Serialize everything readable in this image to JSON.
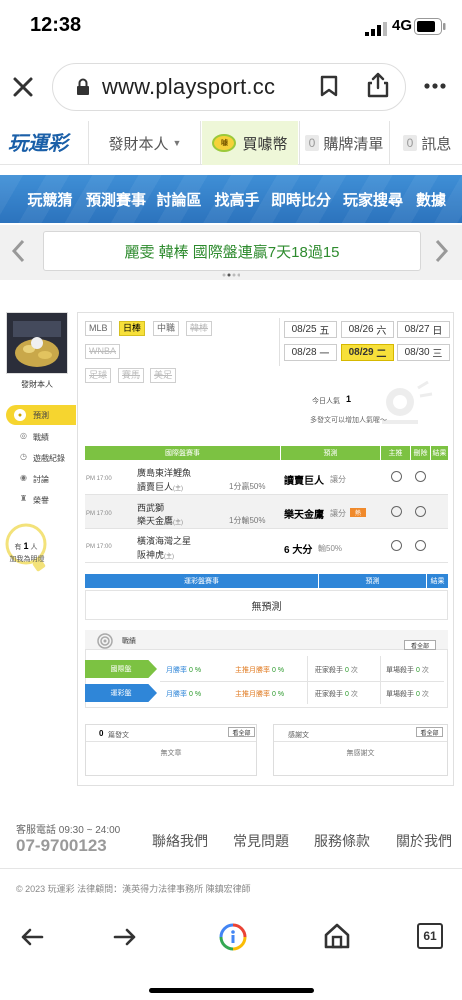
{
  "status_bar": {
    "time": "12:38",
    "network": "4G"
  },
  "browser": {
    "url": "www.playsport.cc",
    "tab_count": "61"
  },
  "header": {
    "logo": "玩運彩",
    "member_label": "發財本人",
    "coin_label": "買噱幣",
    "cart_count": "0",
    "cart_label": "購牌清單",
    "msg_count": "0",
    "msg_label": "訊息"
  },
  "nav": {
    "items": [
      "玩競猜",
      "預測賽事",
      "討論區",
      "找高手",
      "即時比分",
      "玩家搜尋",
      "數據"
    ]
  },
  "banner": {
    "text": "麗雯 韓棒 國際盤連贏7天18過15"
  },
  "sidebar": {
    "name": "發財本人",
    "items": [
      "預測",
      "戰績",
      "遊戲紀錄",
      "討論",
      "榮譽"
    ],
    "added_count": "1",
    "added_prefix": "有",
    "added_suffix": "人",
    "added_line2": "加我為明燈"
  },
  "leagues": {
    "row1": [
      {
        "label": "MLB",
        "state": "normal"
      },
      {
        "label": "日棒",
        "state": "active"
      },
      {
        "label": "中職",
        "state": "normal"
      },
      {
        "label": "韓棒",
        "state": "disabled"
      }
    ],
    "row2": [
      {
        "label": "WNBA",
        "state": "disabled"
      }
    ],
    "row3": [
      {
        "label": "足球",
        "state": "disabled"
      },
      {
        "label": "賽馬",
        "state": "disabled"
      },
      {
        "label": "美足",
        "state": "disabled"
      }
    ]
  },
  "dates": [
    {
      "date": "08/25",
      "day": "五"
    },
    {
      "date": "08/26",
      "day": "六"
    },
    {
      "date": "08/27",
      "day": "日"
    },
    {
      "date": "08/28",
      "day": "一"
    },
    {
      "date": "08/29",
      "day": "二",
      "active": true
    },
    {
      "date": "08/30",
      "day": "三"
    }
  ],
  "popularity": {
    "label": "今日人氣",
    "value": "1",
    "hint": "多發文可以增加人氣喔～"
  },
  "intl_table": {
    "headers": {
      "game": "國際盤賽事",
      "pick": "預測",
      "home": "主推",
      "del": "刪除",
      "result": "結果"
    },
    "rows": [
      {
        "time": "PM 17:00",
        "team1": "廣島東洋鯉魚",
        "team2": "讀賣巨人",
        "team2_tag": "(主)",
        "line": "1分贏50%",
        "pick": "讀賣巨人",
        "pick_tag": "讓分",
        "badge": ""
      },
      {
        "time": "PM 17:00",
        "team1": "西武獅",
        "team2": "樂天金鷹",
        "team2_tag": "(主)",
        "line": "1分輸50%",
        "pick": "樂天金鷹",
        "pick_tag": "讓分",
        "badge": "熱"
      },
      {
        "time": "PM 17:00",
        "team1": "橫濱海灣之星",
        "team2": "阪神虎",
        "team2_tag": "(主)",
        "line": "",
        "pick": "6 大分",
        "pick_tag": "輸50%",
        "badge": ""
      }
    ]
  },
  "lottery_table": {
    "headers": {
      "game": "運彩盤賽事",
      "pick": "預測",
      "result": "結果"
    },
    "empty": "無預測"
  },
  "record": {
    "title": "戰績",
    "see_all": "看全部",
    "rows": [
      {
        "label": "國際盤",
        "win_rate_label": "月勝率",
        "win_rate": "0",
        "win_unit": "%",
        "main_label": "主推月勝率",
        "main_rate": "0",
        "main_unit": "%",
        "kill_label": "莊家殺手",
        "kill_val": "0",
        "kill_unit": "次",
        "single_label": "單場殺手",
        "single_val": "0",
        "single_unit": "次",
        "color": "#7cc242"
      },
      {
        "label": "運彩盤",
        "win_rate_label": "月勝率",
        "win_rate": "0",
        "win_unit": "%",
        "main_label": "主推月勝率",
        "main_rate": "0",
        "main_unit": "%",
        "kill_label": "莊家殺手",
        "kill_val": "0",
        "kill_unit": "次",
        "single_label": "單場殺手",
        "single_val": "0",
        "single_unit": "次",
        "color": "#2f86d8"
      }
    ]
  },
  "posts": {
    "count": "0",
    "label": "篇發文",
    "see_all": "看全部",
    "empty": "無文章"
  },
  "thanks": {
    "label": "感謝文",
    "see_all": "看全部",
    "empty": "無感謝文"
  },
  "footer": {
    "phone_label": "客服電話 09:30 ~ 24:00",
    "phone": "07-9700123",
    "links": [
      "聯絡我們",
      "常見問題",
      "服務條款",
      "關於我們"
    ],
    "copyright": "© 2023 玩運彩 法律顧問：漢英得力法律事務所 陳鎮宏律師"
  }
}
